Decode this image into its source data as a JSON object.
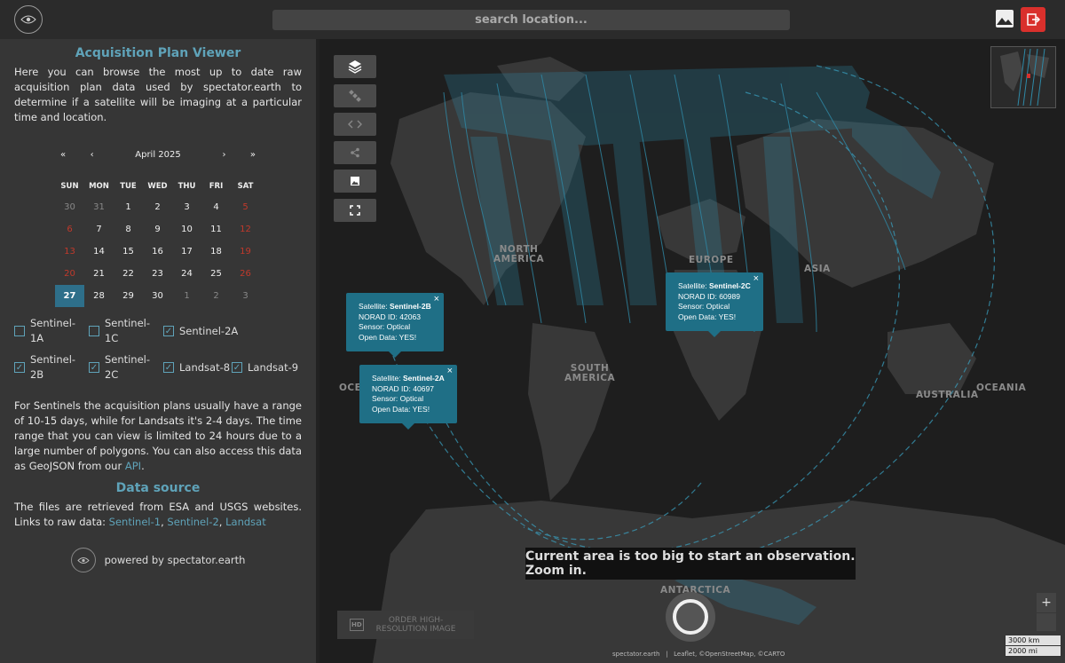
{
  "topbar": {
    "search_placeholder": "search location..."
  },
  "sidebar": {
    "title": "Acquisition Plan Viewer",
    "intro": "Here you can browse the most up to date raw acquisition plan data used by spectator.earth to determine if a satellite will be imaging at a particular time and location.",
    "calendar": {
      "nav_prev_year": "«",
      "nav_prev_month": "‹",
      "month_label": "April 2025",
      "nav_next_month": "›",
      "nav_next_year": "»",
      "weekdays": [
        "SUN",
        "MON",
        "TUE",
        "WED",
        "THU",
        "FRI",
        "SAT"
      ],
      "days": [
        {
          "d": "30",
          "t": "other"
        },
        {
          "d": "31",
          "t": "other"
        },
        {
          "d": "1",
          "t": ""
        },
        {
          "d": "2",
          "t": ""
        },
        {
          "d": "3",
          "t": ""
        },
        {
          "d": "4",
          "t": ""
        },
        {
          "d": "5",
          "t": "weekend"
        },
        {
          "d": "6",
          "t": "weekend"
        },
        {
          "d": "7",
          "t": ""
        },
        {
          "d": "8",
          "t": ""
        },
        {
          "d": "9",
          "t": ""
        },
        {
          "d": "10",
          "t": ""
        },
        {
          "d": "11",
          "t": ""
        },
        {
          "d": "12",
          "t": "weekend"
        },
        {
          "d": "13",
          "t": "weekend"
        },
        {
          "d": "14",
          "t": ""
        },
        {
          "d": "15",
          "t": ""
        },
        {
          "d": "16",
          "t": ""
        },
        {
          "d": "17",
          "t": ""
        },
        {
          "d": "18",
          "t": ""
        },
        {
          "d": "19",
          "t": "weekend"
        },
        {
          "d": "20",
          "t": "weekend"
        },
        {
          "d": "21",
          "t": ""
        },
        {
          "d": "22",
          "t": ""
        },
        {
          "d": "23",
          "t": ""
        },
        {
          "d": "24",
          "t": ""
        },
        {
          "d": "25",
          "t": ""
        },
        {
          "d": "26",
          "t": "weekend"
        },
        {
          "d": "27",
          "t": "today"
        },
        {
          "d": "28",
          "t": ""
        },
        {
          "d": "29",
          "t": ""
        },
        {
          "d": "30",
          "t": ""
        },
        {
          "d": "1",
          "t": "other"
        },
        {
          "d": "2",
          "t": "other"
        },
        {
          "d": "3",
          "t": "other"
        }
      ]
    },
    "satellites_row1": [
      {
        "label": "Sentinel-1A",
        "checked": false
      },
      {
        "label": "Sentinel-1C",
        "checked": false
      },
      {
        "label": "Sentinel-2A",
        "checked": true
      }
    ],
    "satellites_row2": [
      {
        "label": "Sentinel-2B",
        "checked": true
      },
      {
        "label": "Sentinel-2C",
        "checked": true
      },
      {
        "label": "Landsat-8",
        "checked": true
      },
      {
        "label": "Landsat-9",
        "checked": true
      }
    ],
    "range_text": "For Sentinels the acquisition plans usually have a range of 10-15 days, while for Landsats it's 2-4 days. The time range that you can view is limited to 24 hours due to a large number of polygons. You can also access this data as GeoJSON from our",
    "range_link": "API",
    "range_end": ".",
    "datasource_title": "Data source",
    "datasource_text": "The files are retrieved from ESA and USGS websites. Links to raw data:",
    "link_s1": "Sentinel-1",
    "link_s2": "Sentinel-2",
    "link_landsat": "Landsat",
    "sep": ",",
    "powered": "powered by spectator.earth"
  },
  "map": {
    "labels": {
      "north_america": "NORTH\nAMERICA",
      "south_america": "SOUTH\nAMERICA",
      "europe": "EUROPE",
      "asia": "ASIA",
      "australia": "AUSTRALIA",
      "oceania": "OCEANIA",
      "oceania_left": "OCEA",
      "antarctica": "ANTARCTICA"
    },
    "popups": [
      {
        "sat_prefix": "Satellite: ",
        "sat": "Sentinel-2B",
        "norad": "NORAD ID: 42063",
        "sensor": "Sensor: Optical",
        "open": "Open Data: YES!"
      },
      {
        "sat_prefix": "Satellite: ",
        "sat": "Sentinel-2A",
        "norad": "NORAD ID: 40697",
        "sensor": "Sensor: Optical",
        "open": "Open Data: YES!"
      },
      {
        "sat_prefix": "Satellite: ",
        "sat": "Sentinel-2C",
        "norad": "NORAD ID: 60989",
        "sensor": "Sensor: Optical",
        "open": "Open Data: YES!"
      }
    ],
    "close": "×",
    "zoom_message": "Current area is too big to start an observation. Zoom in.",
    "order_button": "ORDER HIGH-\nRESOLUTION IMAGE",
    "order_icon": "HD",
    "zoom_in": "+",
    "scale_km": "3000 km",
    "scale_mi": "2000 mi",
    "attribution": "spectator.earth   |   Leaflet, ©OpenStreetMap, ©CARTO"
  },
  "colors": {
    "accent": "#5fa3b9",
    "popup": "#1f6f86",
    "logout": "#d9302c",
    "weekend": "#c0392b"
  }
}
